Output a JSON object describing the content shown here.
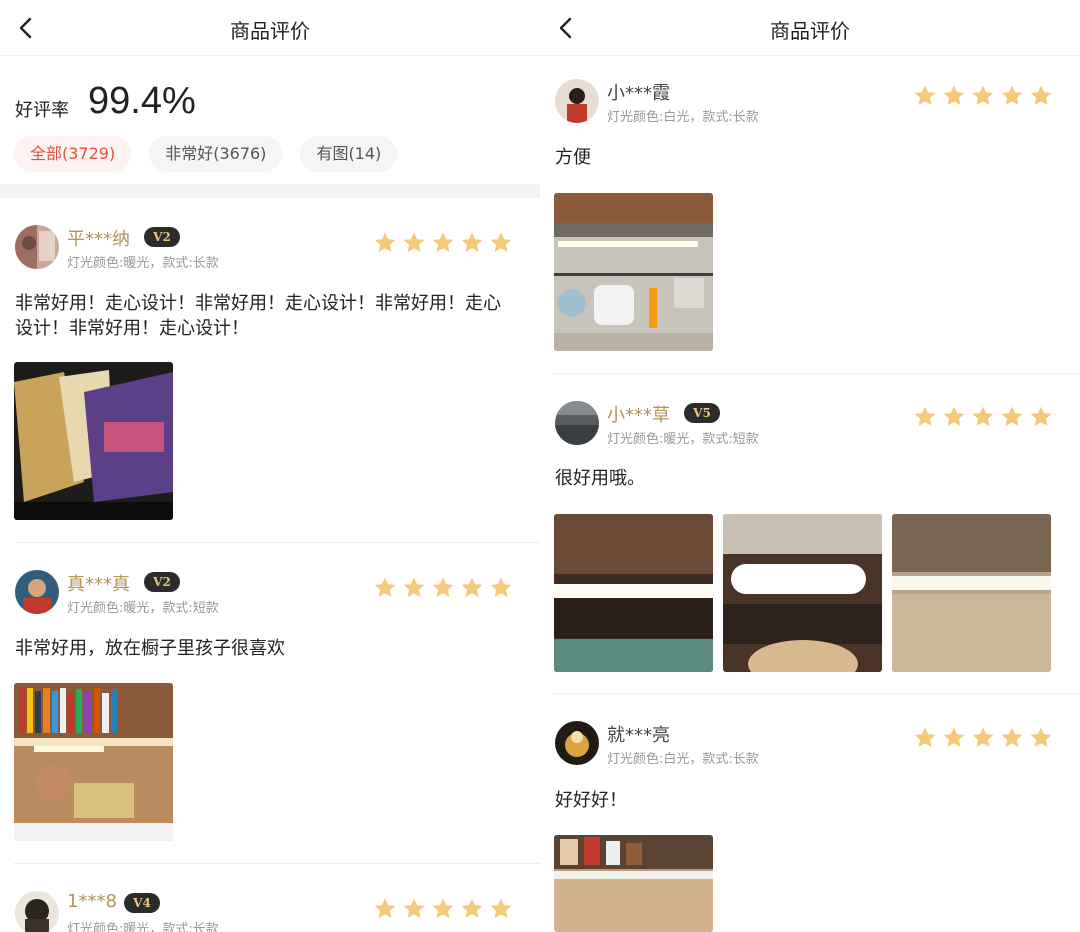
{
  "left": {
    "nav": {
      "title": "商品评价",
      "back_icon": "chevron-left-icon"
    },
    "summary": {
      "rate_label": "好评率",
      "rate_value": "99.4%"
    },
    "filters": [
      {
        "label": "全部(3729)",
        "active": true
      },
      {
        "label": "非常好(3676)",
        "active": false
      },
      {
        "label": "有图(14)",
        "active": false
      }
    ],
    "reviews": [
      {
        "user": "平***纳",
        "level": "V2",
        "spec": "灯光颜色:暖光，款式:长款",
        "stars": 5,
        "text_lines": [
          "非常好用！走心设计！非常好用！走心设计！非常好用！走心",
          "设计！非常好用！走心设计！"
        ]
      },
      {
        "user": "真***真",
        "level": "V2",
        "spec": "灯光颜色:暖光，款式:短款",
        "stars": 5,
        "text_lines": [
          "非常好用，放在橱子里孩子很喜欢"
        ]
      },
      {
        "user": "1***8",
        "level": "V4",
        "spec": "灯光颜色:暖光，款式:长款",
        "stars": 5,
        "text_lines": []
      }
    ]
  },
  "right": {
    "nav": {
      "title": "商品评价",
      "back_icon": "chevron-left-icon"
    },
    "reviews": [
      {
        "user": "小***霞",
        "level": "",
        "spec": "灯光颜色:白光，款式:长款",
        "stars": 5,
        "text_lines": [
          "方便"
        ]
      },
      {
        "user": "小***草",
        "level": "V5",
        "spec": "灯光颜色:暖光，款式:短款",
        "stars": 5,
        "text_lines": [
          "很好用哦。"
        ]
      },
      {
        "user": "就***亮",
        "level": "",
        "spec": "灯光颜色:白光，款式:长款",
        "stars": 5,
        "text_lines": [
          "好好好！"
        ]
      }
    ]
  },
  "colors": {
    "star": "#f6c97a",
    "accent": "#e3513f",
    "gold_name": "#b39453"
  }
}
